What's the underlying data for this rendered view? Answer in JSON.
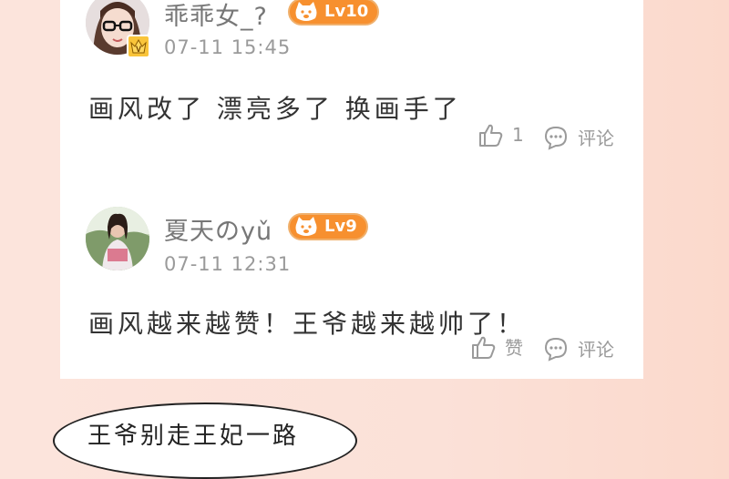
{
  "comments": [
    {
      "username": "乖乖女_?",
      "level": "Lv10",
      "time": "07-11 15:45",
      "text": "画风改了 漂亮多了 换画手了",
      "like_label": "1",
      "reply_label": "评论",
      "vip_badge": "V"
    },
    {
      "username": "夏天のyǔ",
      "level": "Lv9",
      "time": "07-11 12:31",
      "text": "画风越来越赞！王爷越来越帅了！",
      "like_label": "赞",
      "reply_label": "评论"
    }
  ],
  "comic_bubble_text": "王爷别走王妃一路",
  "colors": {
    "badge_orange": "#f7902f",
    "text_gray": "#777777",
    "background_peach": "#fbe1d8"
  },
  "icons": [
    "thumbs-up-icon",
    "comment-bubble-icon",
    "cat-face-icon",
    "vip-crown-icon"
  ]
}
